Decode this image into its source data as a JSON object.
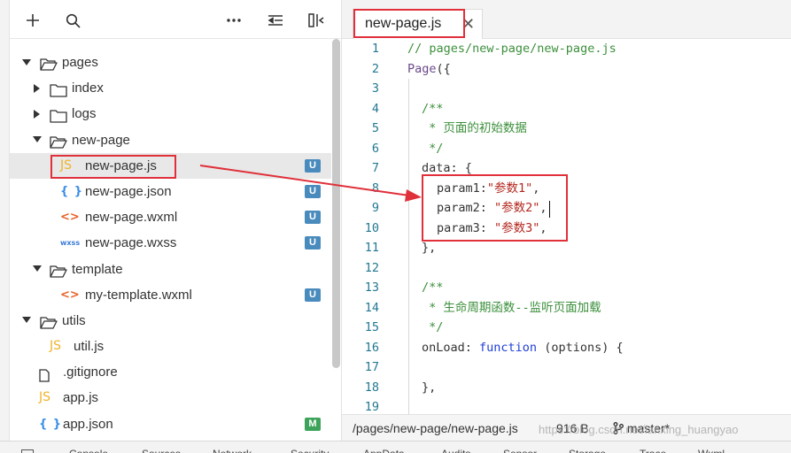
{
  "explorer": {
    "tree": [
      {
        "label": "pages",
        "kind": "folder",
        "open": true,
        "depth": 0
      },
      {
        "label": "index",
        "kind": "folder",
        "open": false,
        "depth": 1
      },
      {
        "label": "logs",
        "kind": "folder",
        "open": false,
        "depth": 1
      },
      {
        "label": "new-page",
        "kind": "folder",
        "open": true,
        "depth": 1
      },
      {
        "label": "new-page.js",
        "kind": "js",
        "icon": "JS",
        "badge": "U",
        "selected": true,
        "depth": 2
      },
      {
        "label": "new-page.json",
        "kind": "json",
        "icon": "{ }",
        "badge": "U",
        "depth": 2
      },
      {
        "label": "new-page.wxml",
        "kind": "wxml",
        "icon": "<>",
        "badge": "U",
        "depth": 2
      },
      {
        "label": "new-page.wxss",
        "kind": "wxss",
        "icon": "wxss",
        "badge": "U",
        "depth": 2
      },
      {
        "label": "template",
        "kind": "folder",
        "open": true,
        "depth": 1
      },
      {
        "label": "my-template.wxml",
        "kind": "wxml",
        "icon": "<>",
        "badge": "U",
        "depth": 2
      },
      {
        "label": "utils",
        "kind": "folder",
        "open": true,
        "depth": 0
      },
      {
        "label": "util.js",
        "kind": "js",
        "icon": "JS",
        "depth": 1
      },
      {
        "label": ".gitignore",
        "kind": "plain",
        "depth": 0
      },
      {
        "label": "app.js",
        "kind": "js",
        "icon": "JS",
        "depth": 0
      },
      {
        "label": "app.json",
        "kind": "json",
        "icon": "{ }",
        "badge": "M",
        "depth": 0
      }
    ]
  },
  "editor": {
    "tab_label": "new-page.js",
    "tab_close": "✕",
    "lines": [
      {
        "n": "1",
        "parts": [
          {
            "t": "// pages/new-page/new-page.js",
            "c": "comment"
          }
        ],
        "indent": 0
      },
      {
        "n": "2",
        "parts": [
          {
            "t": "Page",
            "c": "fn"
          },
          {
            "t": "({",
            "c": ""
          }
        ],
        "indent": 0
      },
      {
        "n": "3",
        "parts": [],
        "indent": 0
      },
      {
        "n": "4",
        "parts": [
          {
            "t": "/**",
            "c": "comment"
          }
        ],
        "indent": 1
      },
      {
        "n": "5",
        "parts": [
          {
            "t": " * 页面的初始数据",
            "c": "comment"
          }
        ],
        "indent": 1
      },
      {
        "n": "6",
        "parts": [
          {
            "t": " */",
            "c": "comment"
          }
        ],
        "indent": 1
      },
      {
        "n": "7",
        "parts": [
          {
            "t": "data: {",
            "c": ""
          }
        ],
        "indent": 1
      },
      {
        "n": "8",
        "parts": [
          {
            "t": "param1:",
            "c": ""
          },
          {
            "t": "\"参数1\"",
            "c": "string"
          },
          {
            "t": ",",
            "c": ""
          }
        ],
        "indent": 2
      },
      {
        "n": "9",
        "parts": [
          {
            "t": "param2: ",
            "c": ""
          },
          {
            "t": "\"参数2\"",
            "c": "string"
          },
          {
            "t": ",",
            "c": ""
          }
        ],
        "indent": 2
      },
      {
        "n": "10",
        "parts": [
          {
            "t": "param3: ",
            "c": ""
          },
          {
            "t": "\"参数3\"",
            "c": "string"
          },
          {
            "t": ",",
            "c": ""
          }
        ],
        "indent": 2
      },
      {
        "n": "11",
        "parts": [
          {
            "t": "},",
            "c": ""
          }
        ],
        "indent": 1
      },
      {
        "n": "12",
        "parts": [],
        "indent": 0
      },
      {
        "n": "13",
        "parts": [
          {
            "t": "/**",
            "c": "comment"
          }
        ],
        "indent": 1
      },
      {
        "n": "14",
        "parts": [
          {
            "t": " * 生命周期函数--监听页面加载",
            "c": "comment"
          }
        ],
        "indent": 1
      },
      {
        "n": "15",
        "parts": [
          {
            "t": " */",
            "c": "comment"
          }
        ],
        "indent": 1
      },
      {
        "n": "16",
        "parts": [
          {
            "t": "onLoad: ",
            "c": ""
          },
          {
            "t": "function",
            "c": "keyword"
          },
          {
            "t": " (options) {",
            "c": ""
          }
        ],
        "indent": 1
      },
      {
        "n": "17",
        "parts": [],
        "indent": 0
      },
      {
        "n": "18",
        "parts": [
          {
            "t": "},",
            "c": ""
          }
        ],
        "indent": 1
      },
      {
        "n": "19",
        "parts": [],
        "indent": 0
      }
    ]
  },
  "statusbar": {
    "path": "/pages/new-page/new-page.js",
    "size": "916 B",
    "branch": "master*",
    "watermark": "https://blog.csdn.net/lanxing_huangyao"
  },
  "bottom_panel": {
    "tabs": [
      "Console",
      "Sources",
      "Network",
      "Security",
      "AppData",
      "Audits",
      "Sensor",
      "Storage",
      "Trace",
      "Wxml"
    ]
  },
  "colors": {
    "highlight": "#e0303a",
    "badge_untracked": "#4a8bbd",
    "badge_modified": "#3ea35a"
  }
}
